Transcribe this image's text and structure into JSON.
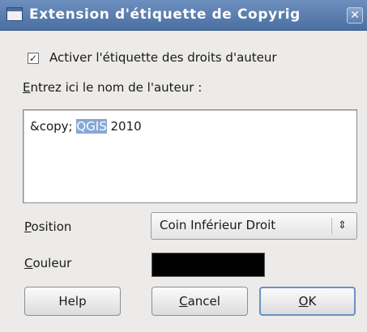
{
  "window": {
    "title": "Extension d'étiquette de Copyrig",
    "close_glyph": "✕",
    "icon": "window-icon"
  },
  "enable_checkbox": {
    "checked": true,
    "label": "Activer l'étiquette des droits d'auteur"
  },
  "author_prompt": {
    "mnemonic": "E",
    "rest": "ntrez ici le nom de l'auteur :"
  },
  "author_text": {
    "before": "&copy; ",
    "selected": "QGIS",
    "after": " 2010"
  },
  "position": {
    "mnemonic": "P",
    "rest": "osition",
    "value": "Coin Inférieur Droit",
    "arrow_glyph": "⇕"
  },
  "color": {
    "mnemonic": "C",
    "rest": "ouleur",
    "value": "#000000"
  },
  "buttons": {
    "help": "Help",
    "cancel_mnemonic": "C",
    "cancel_rest": "ancel",
    "ok_mnemonic": "O",
    "ok_rest": "K"
  }
}
